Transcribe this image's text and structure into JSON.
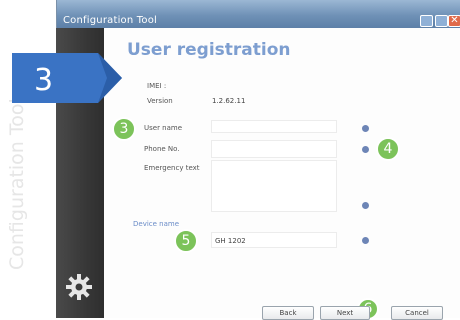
{
  "window": {
    "title": "Configuration Tool"
  },
  "sidebar": {
    "label": "Configuration Tool"
  },
  "page": {
    "heading": "User registration"
  },
  "callouts": {
    "step": "3",
    "markers": [
      "3",
      "4",
      "5",
      "6"
    ]
  },
  "info": {
    "imei_label": "IMEI :",
    "version_label": "Version",
    "version_value": "1.2.62.11"
  },
  "form": {
    "user_name_label": "User name",
    "phone_label": "Phone No.",
    "emergency_label": "Emergency text",
    "device_name_label": "Device name",
    "device_name_value": "GH 1202"
  },
  "buttons": {
    "back": "Back",
    "next": "Next",
    "cancel": "Cancel"
  },
  "colors": {
    "accent": "#7d9ed0",
    "step_badge": "#3a73c4",
    "marker": "#7cc35a"
  }
}
